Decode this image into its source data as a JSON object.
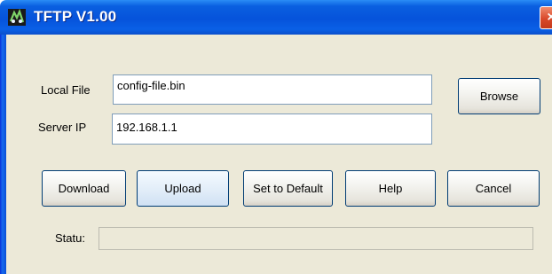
{
  "window": {
    "title": "TFTP V1.00",
    "close_glyph": "×",
    "icon": "tftp-app-icon"
  },
  "form": {
    "local_file_label": "Local File",
    "local_file_value": "config-file.bin",
    "server_ip_label": "Server IP",
    "server_ip_value": "192.168.1.1"
  },
  "buttons": {
    "browse": "Browse",
    "download": "Download",
    "upload": "Upload",
    "set_default": "Set to Default",
    "help": "Help",
    "cancel": "Cancel"
  },
  "status": {
    "label": "Statu:",
    "value": ""
  },
  "colors": {
    "titlebar": "#0653db",
    "window_bg": "#ece9d8",
    "close_button": "#d9492a"
  }
}
